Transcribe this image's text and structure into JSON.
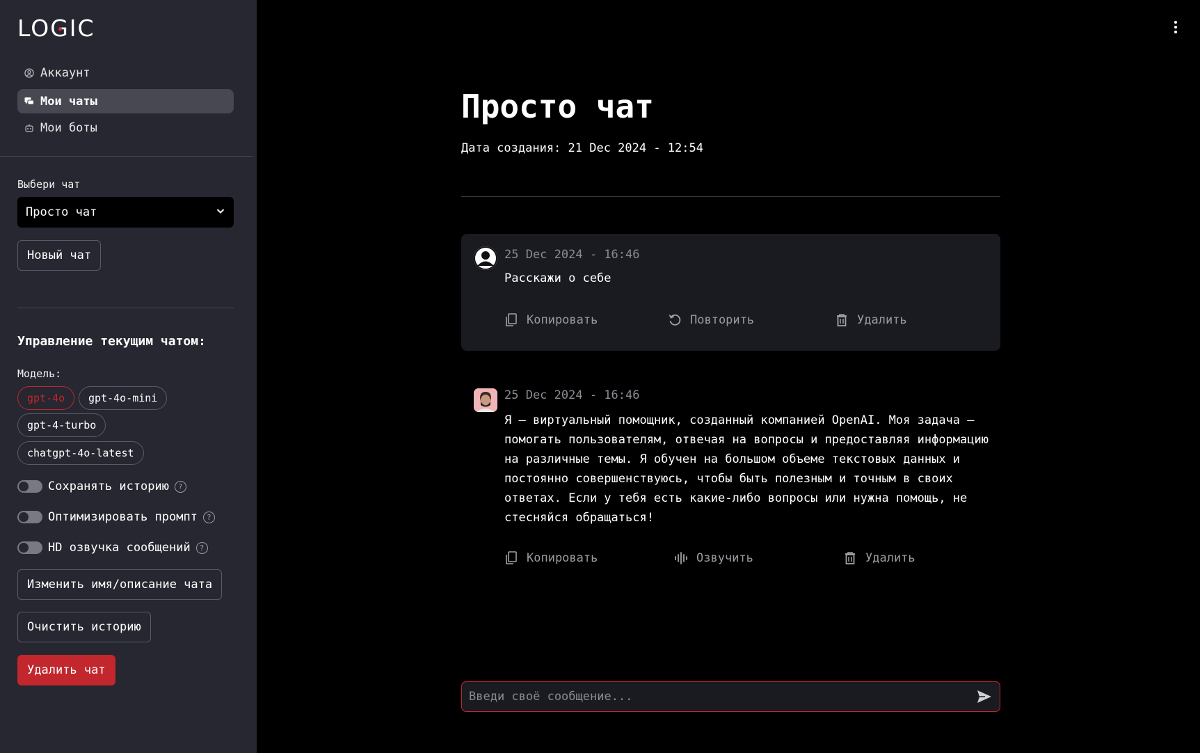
{
  "brand": {
    "logo": "LOGIC"
  },
  "sidebar": {
    "nav": [
      {
        "label": "Аккаунт",
        "icon": "account-icon"
      },
      {
        "label": "Мои чаты",
        "icon": "chats-icon",
        "active": true
      },
      {
        "label": "Мои боты",
        "icon": "bot-icon"
      }
    ],
    "chat_select_label": "Выбери чат",
    "chat_select_value": "Просто чат",
    "new_chat": "Новый чат",
    "manage_title": "Управление текущим чатом:",
    "model_label": "Модель:",
    "models": [
      {
        "label": "gpt-4o",
        "selected": true
      },
      {
        "label": "gpt-4o-mini",
        "selected": false
      },
      {
        "label": "gpt-4-turbo",
        "selected": false
      },
      {
        "label": "chatgpt-4o-latest",
        "selected": false
      }
    ],
    "toggles": [
      {
        "label": "Сохранять историю",
        "on": false
      },
      {
        "label": "Оптимизировать промпт",
        "on": false
      },
      {
        "label": "HD озвучка сообщений",
        "on": false
      }
    ],
    "rename_btn": "Изменить имя/описание чата",
    "clear_btn": "Очистить историю",
    "delete_btn": "Удалить чат"
  },
  "main": {
    "title": "Просто чат",
    "created": "Дата создания: 21 Dec 2024 - 12:54",
    "messages": [
      {
        "role": "user",
        "timestamp": "25 Dec 2024 - 16:46",
        "text": "Расскажи о себе",
        "actions": [
          "Копировать",
          "Повторить",
          "Удалить"
        ]
      },
      {
        "role": "assistant",
        "timestamp": "25 Dec 2024 - 16:46",
        "text": "Я — виртуальный помощник, созданный компанией OpenAI. Моя задача — помогать пользователям, отвечая на вопросы и предоставляя информацию на различные темы. Я обучен на большом объеме текстовых данных и постоянно совершенствуюсь, чтобы быть полезным и точным в своих ответах. Если у тебя есть какие-либо вопросы или нужна помощь, не стесняйся обращаться!",
        "actions": [
          "Копировать",
          "Озвучить",
          "Удалить"
        ]
      }
    ],
    "input_placeholder": "Введи своё сообщение..."
  },
  "colors": {
    "accent": "#c1272d",
    "sidebar_bg": "#262730",
    "main_bg": "#000000",
    "card_bg": "#1a1b21"
  }
}
